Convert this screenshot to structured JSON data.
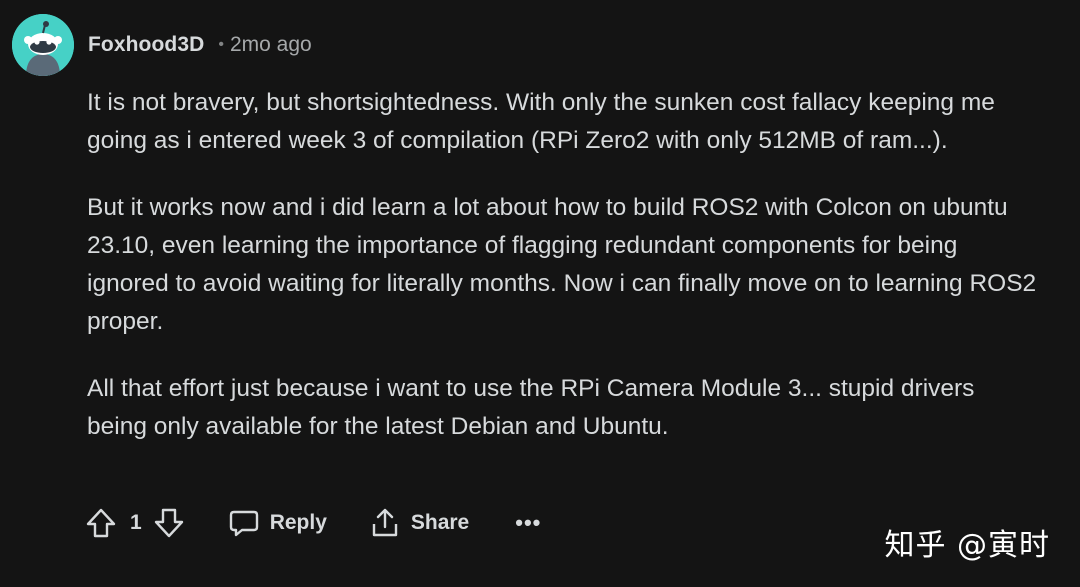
{
  "comment": {
    "author": "Foxhood3D",
    "separator": "•",
    "timestamp": "2mo ago",
    "paragraphs": [
      "It is not bravery, but shortsightedness. With only the sunken cost fallacy keeping me going as i entered week 3 of compilation (RPi Zero2 with only 512MB of ram...).",
      "But it works now and i did learn a lot about how to build ROS2 with Colcon on ubuntu 23.10, even learning the importance of flagging redundant components for being ignored to avoid waiting for literally months. Now i can finally move on to learning ROS2 proper.",
      "All that effort just because i want to use the RPi Camera Module 3... stupid drivers being only available for the latest Debian and Ubuntu."
    ]
  },
  "actions": {
    "vote_count": "1",
    "reply_label": "Reply",
    "share_label": "Share",
    "more_label": "•••"
  },
  "watermark": "知乎 @寅时",
  "colors": {
    "background": "#141414",
    "text": "#d7dadc",
    "muted": "#818384",
    "avatar": "#46d1c6"
  },
  "icons": [
    "snoo-avatar-icon",
    "upvote-icon",
    "downvote-icon",
    "comment-icon",
    "share-icon"
  ]
}
